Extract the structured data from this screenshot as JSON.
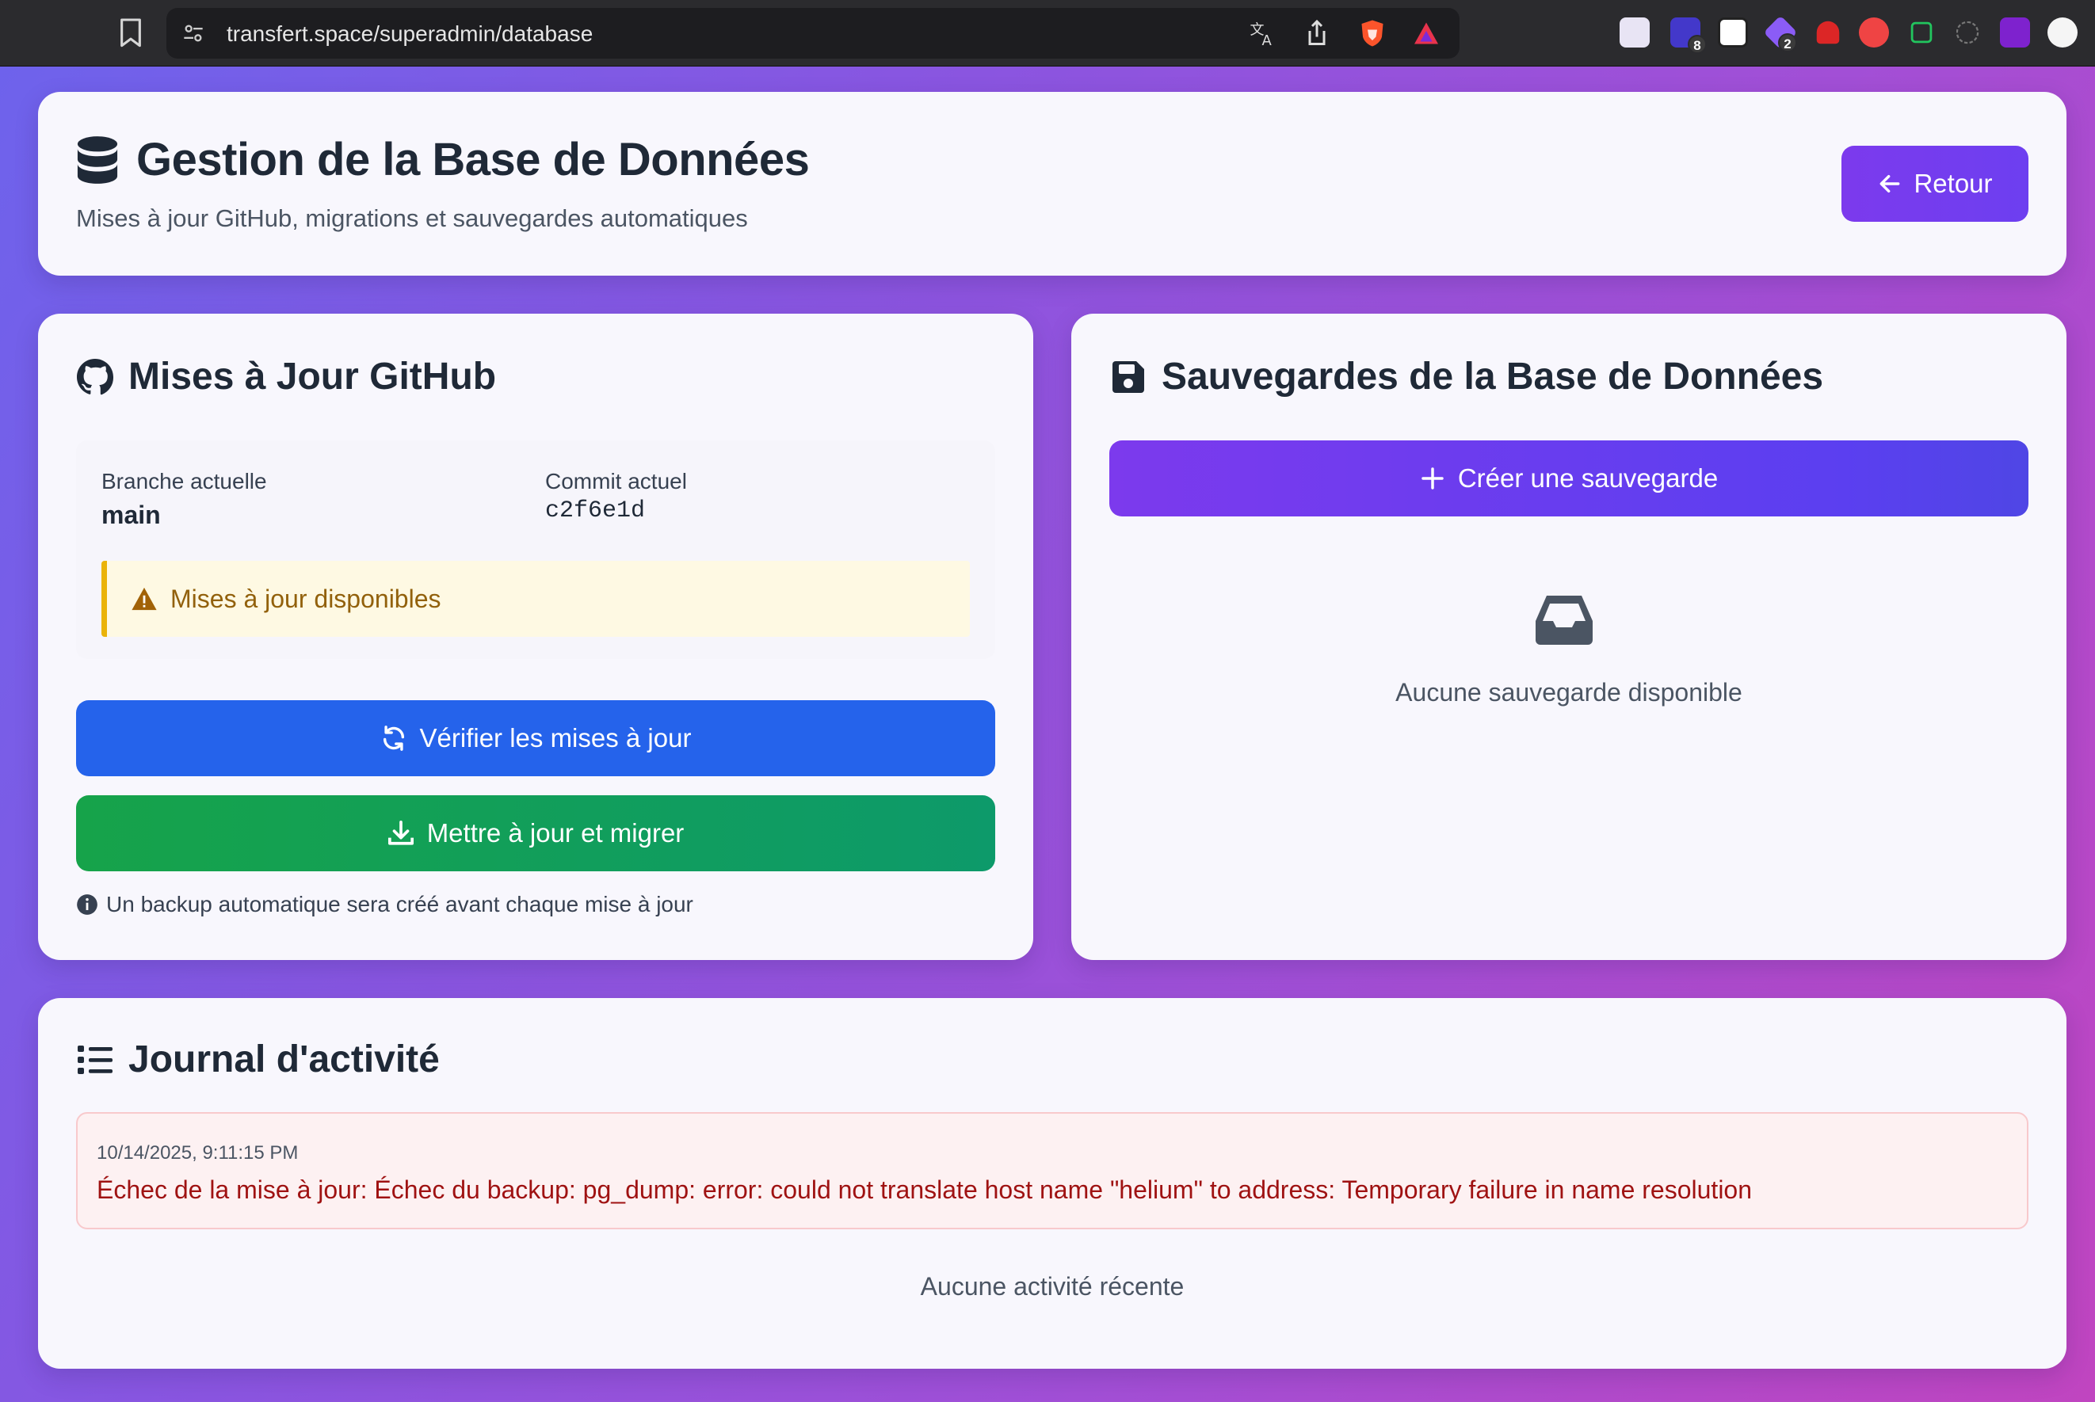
{
  "browser": {
    "url": "transfert.space/superadmin/database",
    "extension_badges": [
      "8",
      "2"
    ]
  },
  "header": {
    "title": "Gestion de la Base de Données",
    "subtitle": "Mises à jour GitHub, migrations et sauvegardes automatiques",
    "back_label": "Retour"
  },
  "github": {
    "title": "Mises à Jour GitHub",
    "branch_label": "Branche actuelle",
    "branch_value": "main",
    "commit_label": "Commit actuel",
    "commit_value": "c2f6e1d",
    "alert": "Mises à jour disponibles",
    "check_button": "Vérifier les mises à jour",
    "update_button": "Mettre à jour et migrer",
    "footnote": "Un backup automatique sera créé avant chaque mise à jour"
  },
  "backups": {
    "title": "Sauvegardes de la Base de Données",
    "create_button": "Créer une sauvegarde",
    "empty_text": "Aucune sauvegarde disponible"
  },
  "activity": {
    "title": "Journal d'activité",
    "entries": [
      {
        "time": "10/14/2025, 9:11:15 PM",
        "message": "Échec de la mise à jour: Échec du backup: pg_dump: error: could not translate host name \"helium\" to address: Temporary failure in name resolution"
      }
    ],
    "empty_text": "Aucune activité récente"
  },
  "colors": {
    "accent_purple": "#7c3aed",
    "primary_blue": "#2563eb",
    "success_green": "#16a34a",
    "warning_yellow": "#eab308",
    "error_red": "#9f1212"
  }
}
